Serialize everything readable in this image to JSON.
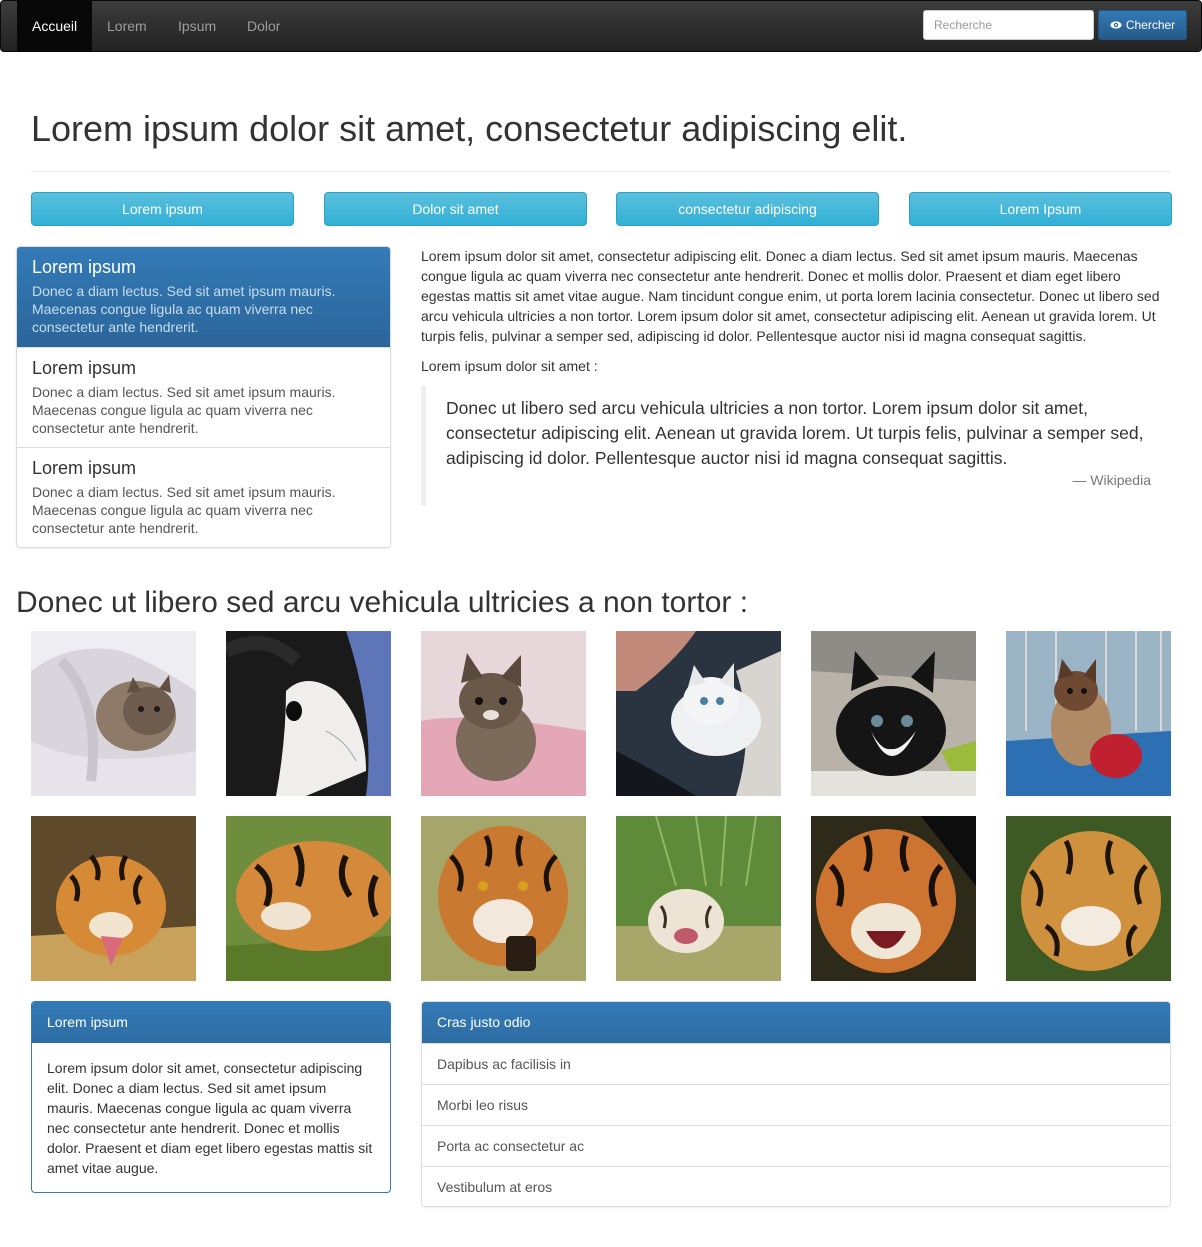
{
  "navbar": {
    "items": [
      {
        "label": "Accueil"
      },
      {
        "label": "Lorem"
      },
      {
        "label": "Ipsum"
      },
      {
        "label": "Dolor"
      }
    ],
    "search_placeholder": "Recherche",
    "search_button": "Chercher"
  },
  "header": {
    "title": "Lorem ipsum dolor sit amet, consectetur adipiscing elit."
  },
  "buttons": [
    {
      "label": "Lorem ipsum"
    },
    {
      "label": "Dolor sit amet"
    },
    {
      "label": "consectetur adipiscing"
    },
    {
      "label": "Lorem Ipsum"
    }
  ],
  "list_group": [
    {
      "heading": "Lorem ipsum",
      "text": "Donec a diam lectus. Sed sit amet ipsum mauris. Maecenas congue ligula ac quam viverra nec consectetur ante hendrerit."
    },
    {
      "heading": "Lorem ipsum",
      "text": "Donec a diam lectus. Sed sit amet ipsum mauris. Maecenas congue ligula ac quam viverra nec consectetur ante hendrerit."
    },
    {
      "heading": "Lorem ipsum",
      "text": "Donec a diam lectus. Sed sit amet ipsum mauris. Maecenas congue ligula ac quam viverra nec consectetur ante hendrerit."
    }
  ],
  "main": {
    "paragraph": "Lorem ipsum dolor sit amet, consectetur adipiscing elit. Donec a diam lectus. Sed sit amet ipsum mauris. Maecenas congue ligula ac quam viverra nec consectetur ante hendrerit. Donec et mollis dolor. Praesent et diam eget libero egestas mattis sit amet vitae augue. Nam tincidunt congue enim, ut porta lorem lacinia consectetur. Donec ut libero sed arcu vehicula ultricies a non tortor. Lorem ipsum dolor sit amet, consectetur adipiscing elit. Aenean ut gravida lorem. Ut turpis felis, pulvinar a semper sed, adipiscing id dolor. Pellentesque auctor nisi id magna consequat sagittis.",
    "lead": "Lorem ipsum dolor sit amet :",
    "quote": "Donec ut libero sed arcu vehicula ultricies a non tortor. Lorem ipsum dolor sit amet, consectetur adipiscing elit. Aenean ut gravida lorem. Ut turpis felis, pulvinar a semper sed, adipiscing id dolor. Pellentesque auctor nisi id magna consequat sagittis.",
    "quote_source": "— Wikipedia"
  },
  "gallery": {
    "title": "Donec ut libero sed arcu vehicula ultricies a non tortor :"
  },
  "panel": {
    "heading": "Lorem ipsum",
    "body": "Lorem ipsum dolor sit amet, consectetur adipiscing elit. Donec a diam lectus. Sed sit amet ipsum mauris. Maecenas congue ligula ac quam viverra nec consectetur ante hendrerit. Donec et mollis dolor. Praesent et diam eget libero egestas mattis sit amet vitae augue."
  },
  "panel_list": {
    "heading": "Cras justo odio",
    "items": [
      {
        "label": "Dapibus ac facilisis in"
      },
      {
        "label": "Morbi leo risus"
      },
      {
        "label": "Porta ac consectetur ac"
      },
      {
        "label": "Vestibulum at eros"
      }
    ]
  }
}
